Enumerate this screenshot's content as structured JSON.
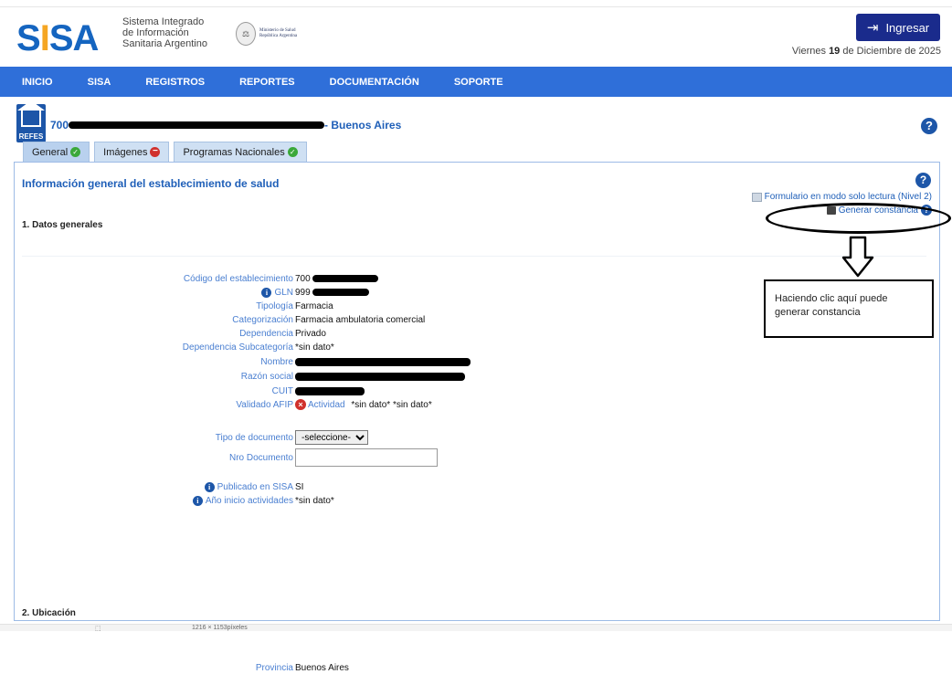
{
  "header": {
    "logo": "SISA",
    "logo_sub": [
      "Sistema Integrado",
      "de Información",
      "Sanitaria Argentino"
    ],
    "ministry": [
      "Ministerio de Salud",
      "República Argentina"
    ],
    "login_label": "Ingresar",
    "date_prefix": "Viernes ",
    "date_day": "19",
    "date_suffix": " de Diciembre de 2025"
  },
  "nav": [
    "INICIO",
    "SISA",
    "REGISTROS",
    "REPORTES",
    "DOCUMENTACIÓN",
    "SOPORTE"
  ],
  "establishment": {
    "badge": "REFES",
    "code_prefix": "700",
    "province_suffix": " - Buenos Aires"
  },
  "tabs": [
    {
      "label": "General",
      "status": "ok"
    },
    {
      "label": "Imágenes",
      "status": "error"
    },
    {
      "label": "Programas Nacionales",
      "status": "ok"
    }
  ],
  "panel": {
    "title": "Información general del establecimiento de salud",
    "readonly_link": "Formulario en modo solo lectura (Nivel 2)",
    "constancia_link": "Generar constancia",
    "section1": "1. Datos generales",
    "section2": "2. Ubicación"
  },
  "fields": {
    "codigo": {
      "label": "Código del establecimiento",
      "value": "700"
    },
    "gln": {
      "label": "GLN",
      "value": "999"
    },
    "tipologia": {
      "label": "Tipología",
      "value": "Farmacia"
    },
    "categorizacion": {
      "label": "Categorización",
      "value": "Farmacia ambulatoria comercial"
    },
    "dependencia": {
      "label": "Dependencia",
      "value": "Privado"
    },
    "dep_sub": {
      "label": "Dependencia Subcategoría",
      "value": "*sin dato*"
    },
    "nombre": {
      "label": "Nombre"
    },
    "razon": {
      "label": "Razón social"
    },
    "cuit": {
      "label": "CUIT"
    },
    "afip": {
      "label": "Validado AFIP",
      "actividad_label": "Actividad",
      "value": "*sin dato* *sin dato*"
    },
    "tipo_doc": {
      "label": "Tipo de documento",
      "selected": "-seleccione-"
    },
    "nro_doc": {
      "label": "Nro Documento",
      "value": ""
    },
    "publicado": {
      "label": "Publicado en SISA",
      "value": "SI"
    },
    "anio": {
      "label": "Año inicio actividades",
      "value": "*sin dato*"
    },
    "provincia": {
      "label": "Provincia",
      "value": "Buenos Aires"
    }
  },
  "annotation": {
    "callout_text": "Haciendo clic aquí puede generar constancia"
  },
  "bottombar": {
    "dims": "1216 × 1153píxeles"
  }
}
